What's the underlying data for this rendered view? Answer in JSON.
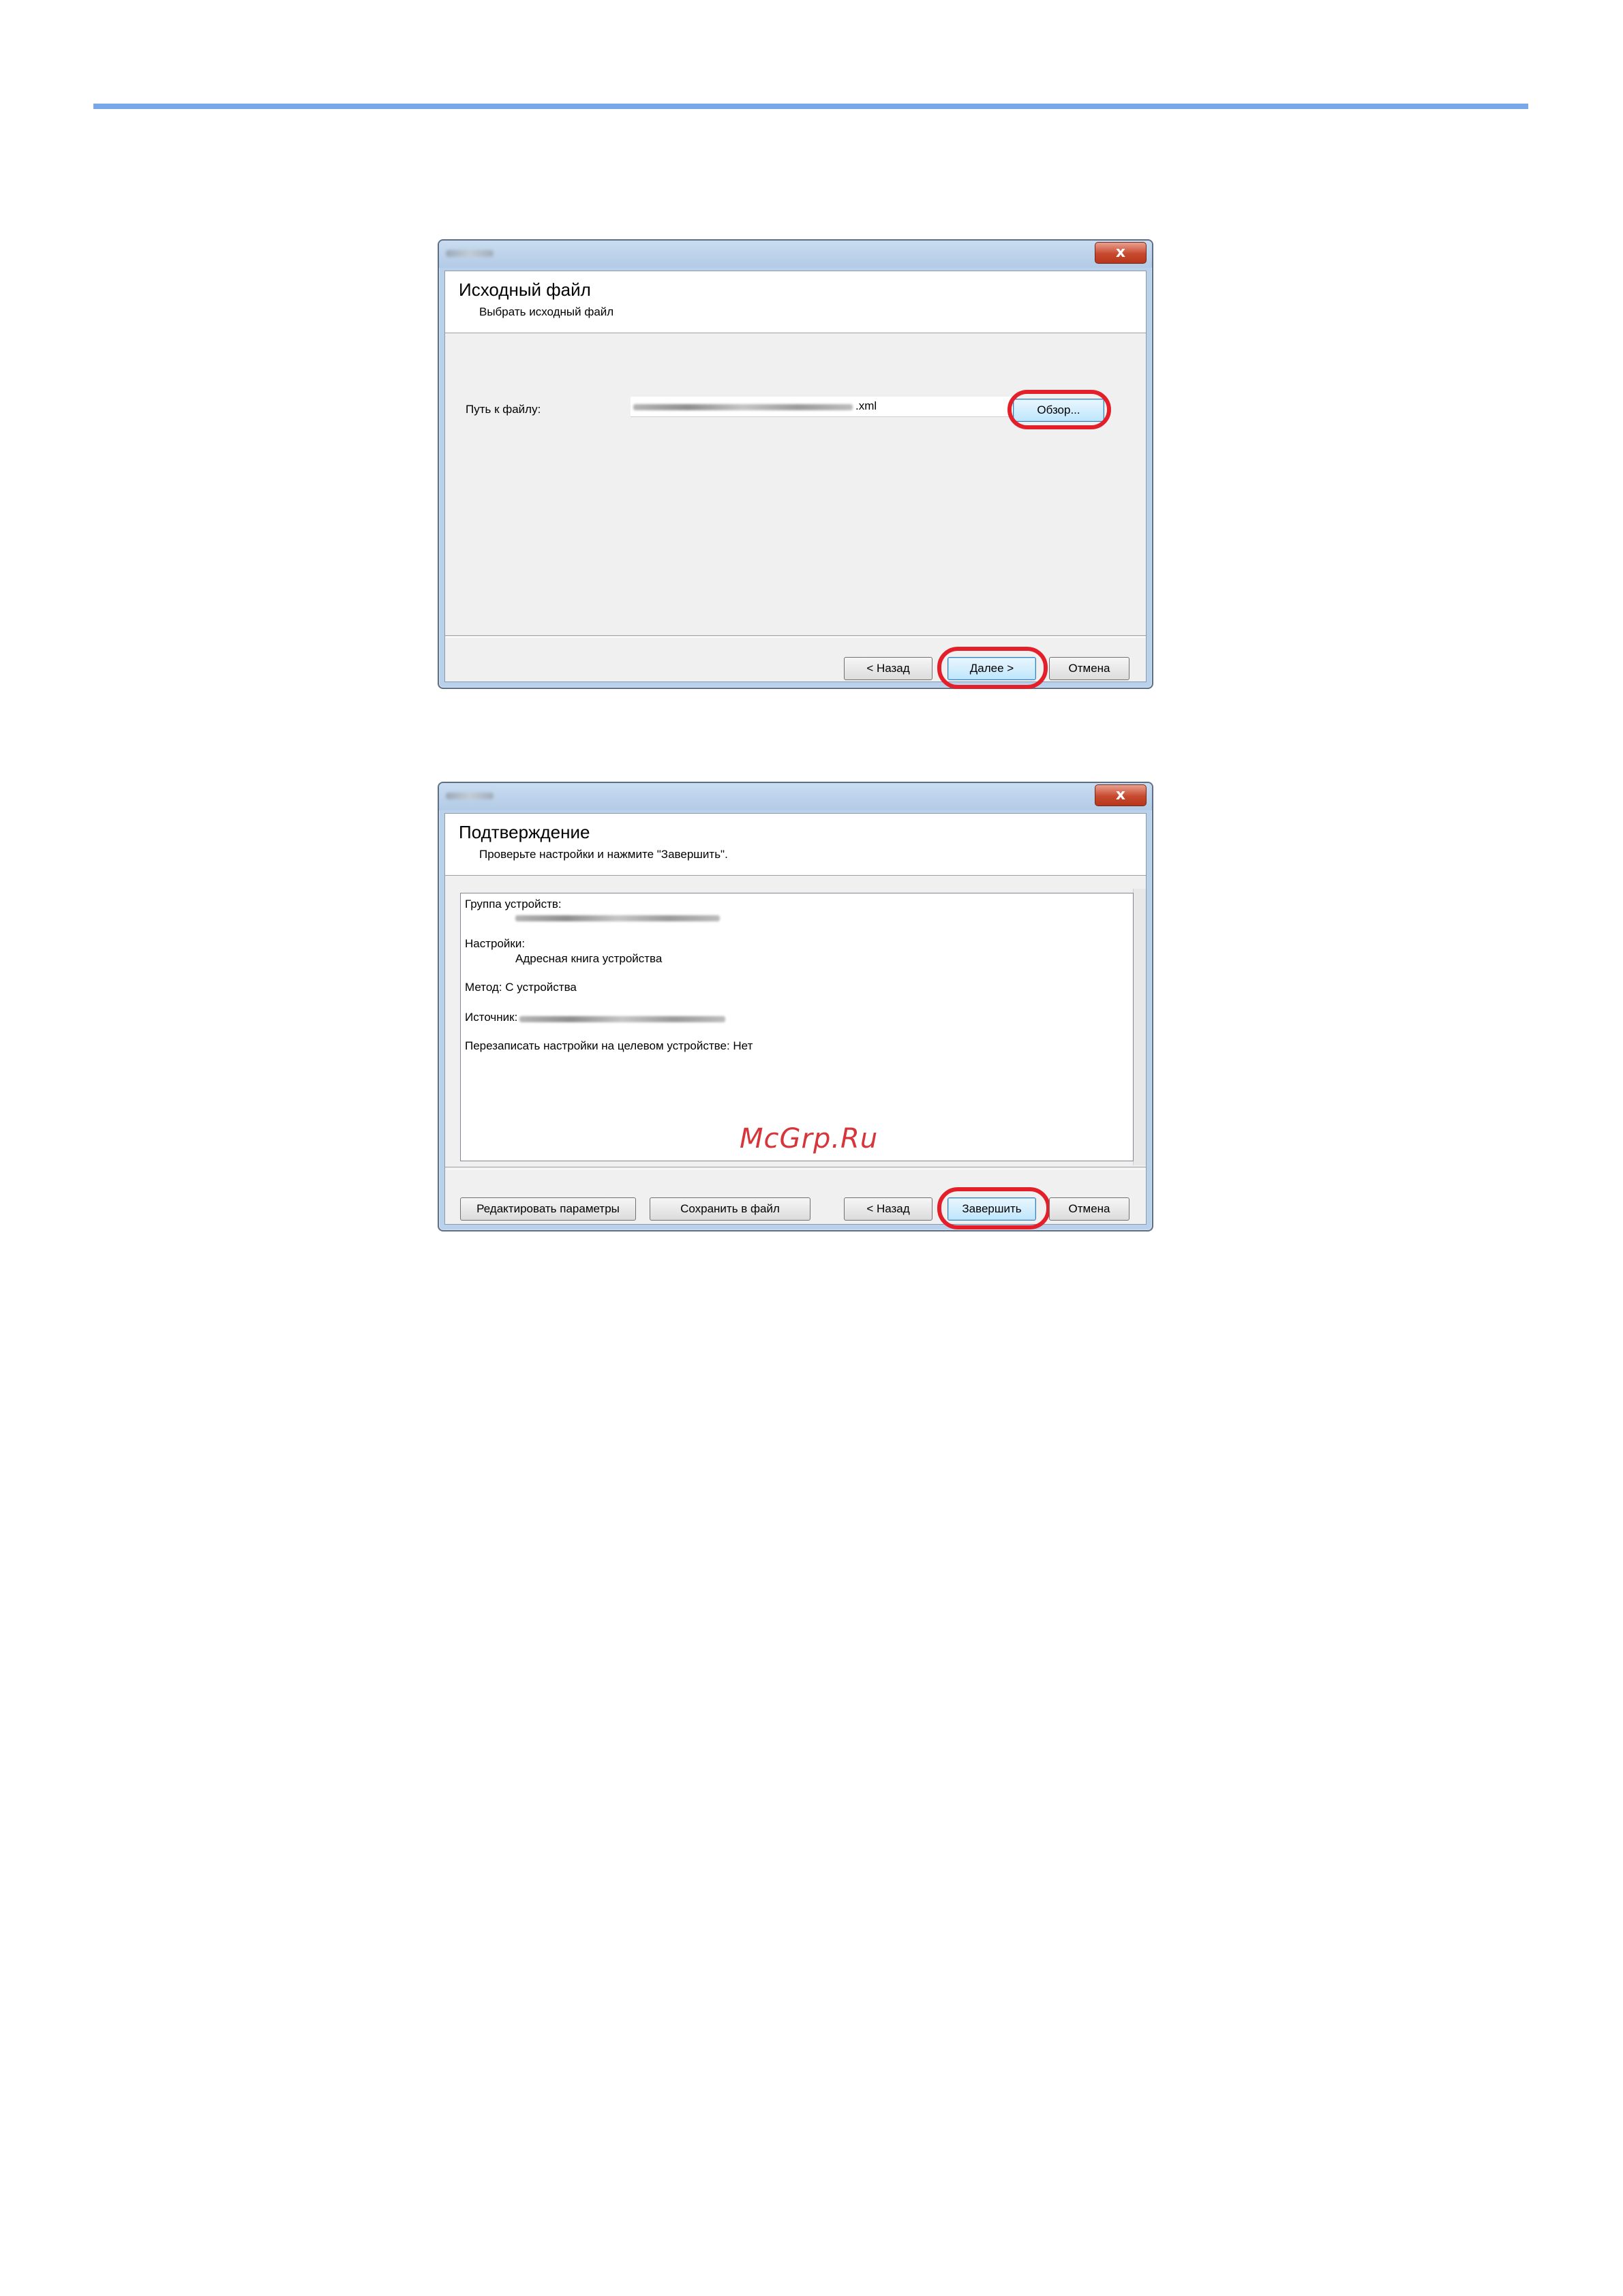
{
  "dialog1": {
    "close_glyph": "x",
    "header_title": "Исходный файл",
    "header_subtitle": "Выбрать исходный файл",
    "path_label": "Путь к файлу:",
    "path_value_suffix": ".xml",
    "browse_label": "Обзор...",
    "back_label": "< Назад",
    "next_label": "Далее >",
    "cancel_label": "Отмена"
  },
  "dialog2": {
    "close_glyph": "x",
    "header_title": "Подтверждение",
    "header_subtitle": "Проверьте настройки и нажмите \"Завершить\".",
    "summary": {
      "device_group_label": "Группа устройств:",
      "settings_label": "Настройки:",
      "settings_value": "Адресная книга устройства",
      "method_line": "Метод: С устройства",
      "source_label": "Источник:",
      "overwrite_line": "Перезаписать настройки на целевом устройстве: Нет"
    },
    "edit_params_label": "Редактировать параметры",
    "save_to_file_label": "Сохранить в файл",
    "back_label": "< Назад",
    "finish_label": "Завершить",
    "cancel_label": "Отмена"
  },
  "watermark": "McGrp.Ru",
  "colors": {
    "top_rule": "#7aa6ea",
    "highlight": "#e3202a",
    "window_frame": "#b9d1ea"
  }
}
